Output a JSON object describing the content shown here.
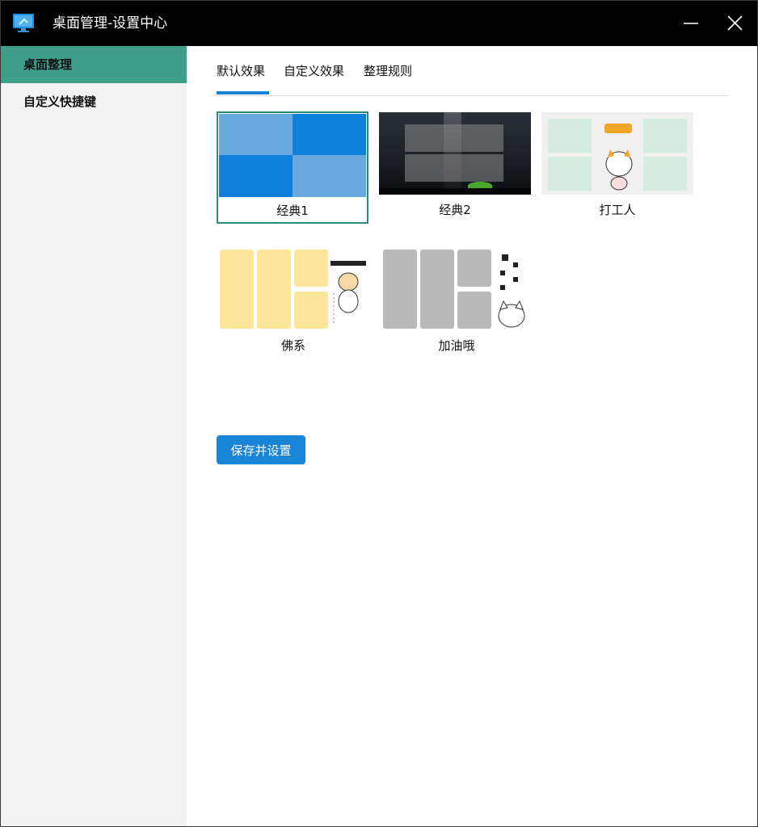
{
  "window": {
    "title": "桌面管理-设置中心"
  },
  "sidebar": {
    "items": [
      {
        "label": "桌面整理"
      },
      {
        "label": "自定义快捷键"
      }
    ]
  },
  "tabs": [
    {
      "label": "默认效果"
    },
    {
      "label": "自定义效果"
    },
    {
      "label": "整理规则"
    }
  ],
  "themes": [
    {
      "label": "经典1",
      "selected": true
    },
    {
      "label": "经典2"
    },
    {
      "label": "打工人"
    },
    {
      "label": "佛系"
    },
    {
      "label": "加油哦"
    }
  ],
  "save_button": {
    "label": "保存并设置"
  },
  "colors": {
    "accent": "#1682d6",
    "sidebar_active": "#3f9e8a",
    "selected_border": "#2a8a7c"
  }
}
